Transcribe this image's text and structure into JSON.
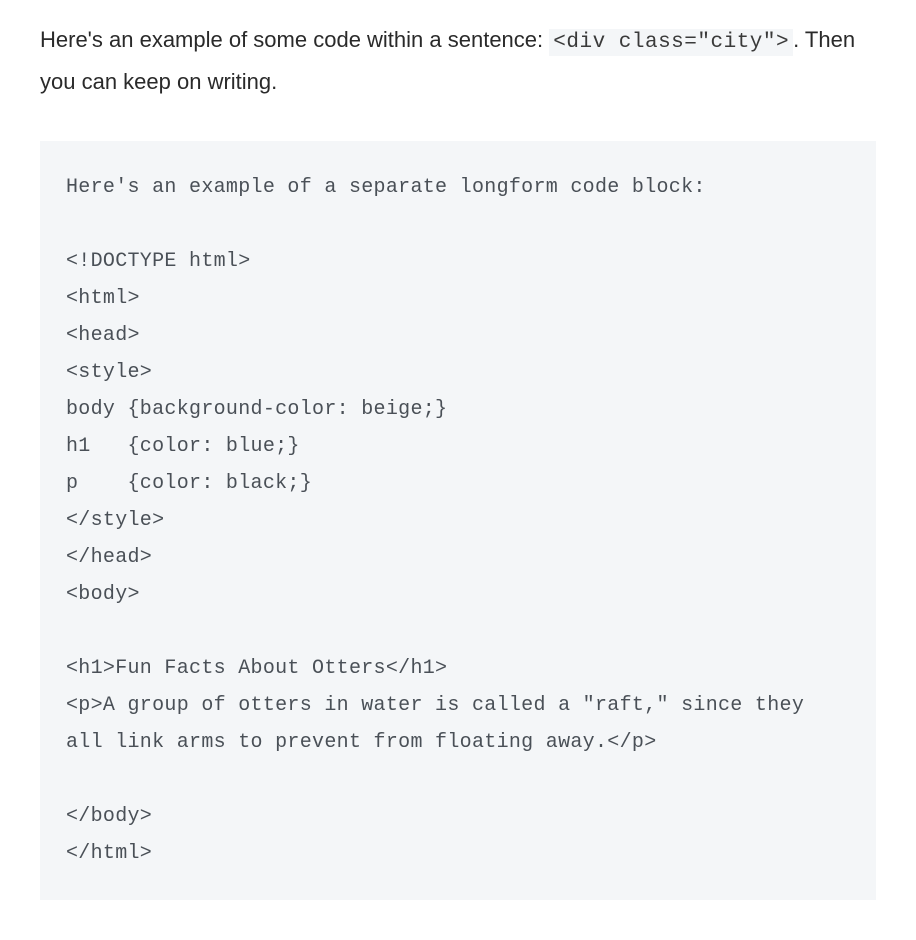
{
  "intro": {
    "before": "Here's an example of some code within a sentence: ",
    "inline_code": "<div class=\"city\">",
    "after": ". Then you can keep on writing."
  },
  "code_block": "Here's an example of a separate longform code block:\n\n<!DOCTYPE html>\n<html>\n<head>\n<style>\nbody {background-color: beige;}\nh1   {color: blue;}\np    {color: black;}\n</style>\n</head>\n<body>\n\n<h1>Fun Facts About Otters</h1>\n<p>A group of otters in water is called a \"raft,\" since they all link arms to prevent from floating away.</p>\n\n</body>\n</html>"
}
